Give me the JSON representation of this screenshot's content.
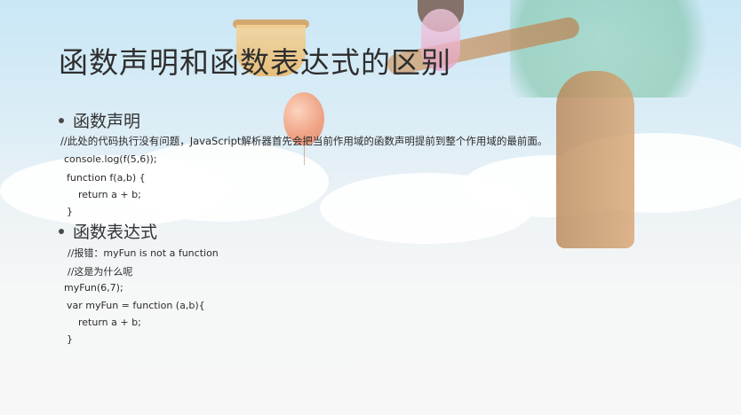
{
  "slide": {
    "title": "函数声明和函数表达式的区别",
    "sections": [
      {
        "heading": "函数声明",
        "lines": [
          "//此处的代码执行没有问题，JavaScript解析器首先会把当前作用域的函数声明提前到整个作用域的最前面。",
          "console.log(f(5,6));",
          "function f(a,b) {",
          "return a + b;",
          "}"
        ]
      },
      {
        "heading": "函数表达式",
        "lines": [
          "//报错：myFun is not a function",
          "//这是为什么呢",
          "myFun(6,7);",
          "var myFun = function (a,b){",
          "return a + b;",
          "}"
        ]
      }
    ]
  }
}
